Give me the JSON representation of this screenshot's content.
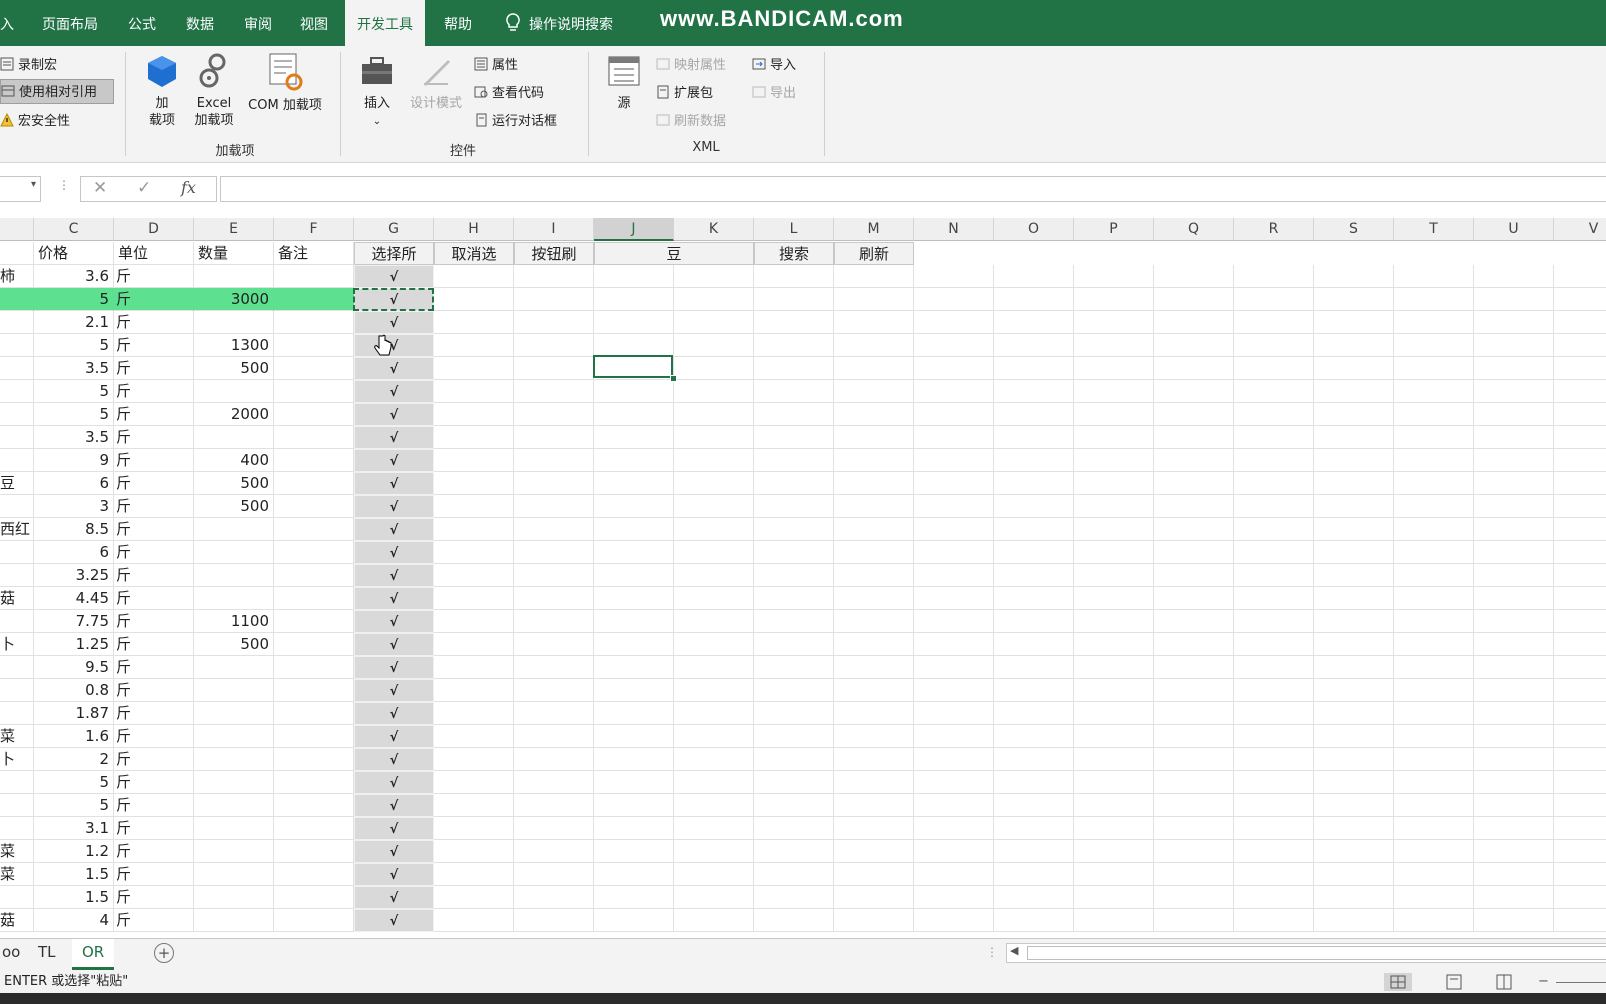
{
  "tabs": [
    {
      "label": "入",
      "active": false
    },
    {
      "label": "页面布局",
      "active": false
    },
    {
      "label": "公式",
      "active": false
    },
    {
      "label": "数据",
      "active": false
    },
    {
      "label": "审阅",
      "active": false
    },
    {
      "label": "视图",
      "active": false
    },
    {
      "label": "开发工具",
      "active": true
    },
    {
      "label": "帮助",
      "active": false
    },
    {
      "label": "操作说明搜索",
      "active": false
    }
  ],
  "watermark": "www.BANDICAM.com",
  "ribbon": {
    "code": {
      "record_macro": "录制宏",
      "relative_ref": "使用相对引用",
      "macro_security": "宏安全性"
    },
    "addins": {
      "addin_label": "加\n载项",
      "addin_l1": "加",
      "addin_l2": "载项",
      "excel_addin_l1": "Excel",
      "excel_addin_l2": "加载项",
      "com_addin": "COM 加载项",
      "group": "加载项"
    },
    "controls": {
      "insert": "插入",
      "design_mode": "设计模式",
      "properties": "属性",
      "view_code": "查看代码",
      "run_dialog": "运行对话框",
      "group": "控件"
    },
    "xml": {
      "source": "源",
      "map_props": "映射属性",
      "expansion": "扩展包",
      "refresh": "刷新数据",
      "import": "导入",
      "export": "导出",
      "group": "XML"
    }
  },
  "accent": "#217346",
  "columns": [
    "C",
    "D",
    "E",
    "F",
    "G",
    "H",
    "I",
    "J",
    "K",
    "L",
    "M",
    "N",
    "O",
    "P",
    "Q",
    "R",
    "S",
    "T",
    "U",
    "V"
  ],
  "header_row": {
    "price": "价格",
    "unit": "单位",
    "qty": "数量",
    "note": "备注",
    "select_all": "选择所",
    "cancel_select": "取消选",
    "button_refresh": "按钮刷",
    "search_value": "豆",
    "search": "搜索",
    "refresh": "刷新"
  },
  "check_mark": "√",
  "rows": [
    {
      "name": "柿",
      "price": "3.6",
      "unit": "斤",
      "qty": ""
    },
    {
      "name": "",
      "price": "5",
      "unit": "斤",
      "qty": "3000"
    },
    {
      "name": "",
      "price": "2.1",
      "unit": "斤",
      "qty": ""
    },
    {
      "name": "",
      "price": "5",
      "unit": "斤",
      "qty": "1300"
    },
    {
      "name": "",
      "price": "3.5",
      "unit": "斤",
      "qty": "500"
    },
    {
      "name": "",
      "price": "5",
      "unit": "斤",
      "qty": ""
    },
    {
      "name": "",
      "price": "5",
      "unit": "斤",
      "qty": "2000"
    },
    {
      "name": "",
      "price": "3.5",
      "unit": "斤",
      "qty": ""
    },
    {
      "name": "",
      "price": "9",
      "unit": "斤",
      "qty": "400"
    },
    {
      "name": "豆",
      "price": "6",
      "unit": "斤",
      "qty": "500"
    },
    {
      "name": "",
      "price": "3",
      "unit": "斤",
      "qty": "500"
    },
    {
      "name": "西红",
      "price": "8.5",
      "unit": "斤",
      "qty": ""
    },
    {
      "name": "",
      "price": "6",
      "unit": "斤",
      "qty": ""
    },
    {
      "name": "",
      "price": "3.25",
      "unit": "斤",
      "qty": ""
    },
    {
      "name": "菇",
      "price": "4.45",
      "unit": "斤",
      "qty": ""
    },
    {
      "name": "",
      "price": "7.75",
      "unit": "斤",
      "qty": "1100"
    },
    {
      "name": "卜",
      "price": "1.25",
      "unit": "斤",
      "qty": "500"
    },
    {
      "name": "",
      "price": "9.5",
      "unit": "斤",
      "qty": ""
    },
    {
      "name": "",
      "price": "0.8",
      "unit": "斤",
      "qty": ""
    },
    {
      "name": "",
      "price": "1.87",
      "unit": "斤",
      "qty": ""
    },
    {
      "name": "菜",
      "price": "1.6",
      "unit": "斤",
      "qty": ""
    },
    {
      "name": "卜",
      "price": "2",
      "unit": "斤",
      "qty": ""
    },
    {
      "name": "",
      "price": "5",
      "unit": "斤",
      "qty": ""
    },
    {
      "name": "",
      "price": "5",
      "unit": "斤",
      "qty": ""
    },
    {
      "name": "",
      "price": "3.1",
      "unit": "斤",
      "qty": ""
    },
    {
      "name": "菜",
      "price": "1.2",
      "unit": "斤",
      "qty": ""
    },
    {
      "name": "菜",
      "price": "1.5",
      "unit": "斤",
      "qty": ""
    },
    {
      "name": "",
      "price": "1.5",
      "unit": "斤",
      "qty": ""
    },
    {
      "name": "菇",
      "price": "4",
      "unit": "斤",
      "qty": ""
    }
  ],
  "sheets": [
    {
      "label": "oo",
      "active": false
    },
    {
      "label": "TL",
      "active": false
    },
    {
      "label": "OR",
      "active": true
    }
  ],
  "status": "ENTER 或选择\"粘贴\""
}
